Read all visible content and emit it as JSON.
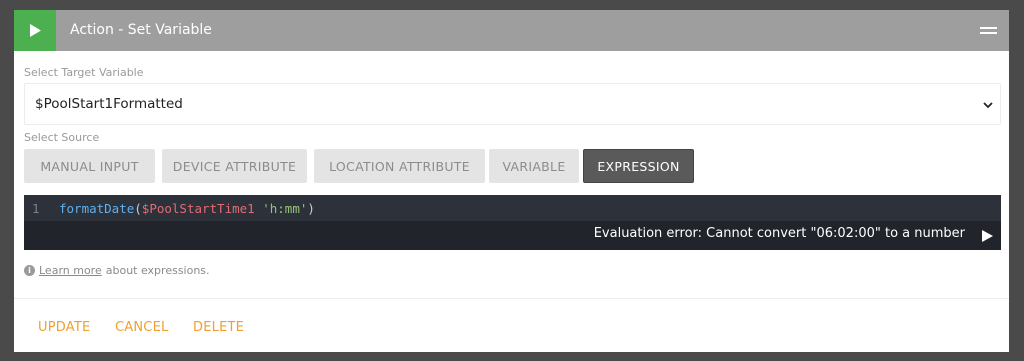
{
  "header": {
    "title": "Action - Set Variable",
    "play_icon": "play-icon",
    "menu_icon": "menu-icon",
    "accent_color": "#4caf50"
  },
  "target": {
    "label": "Select Target Variable",
    "value": "$PoolStart1Formatted"
  },
  "source": {
    "label": "Select Source",
    "buttons": [
      {
        "label": "MANUAL INPUT",
        "active": false
      },
      {
        "label": "DEVICE ATTRIBUTE",
        "active": false
      },
      {
        "label": "LOCATION ATTRIBUTE",
        "active": false
      },
      {
        "label": "VARIABLE",
        "active": false
      },
      {
        "label": "EXPRESSION",
        "active": true
      }
    ]
  },
  "editor": {
    "line_number": "1",
    "tokens": {
      "fn": "formatDate",
      "open": "(",
      "var": "$PoolStartTime1",
      "space": " ",
      "str": "'h:mm'",
      "close": ")"
    },
    "error": "Evaluation error: Cannot convert \"06:02:00\" to a number"
  },
  "help": {
    "link": "Learn more",
    "text": "about expressions."
  },
  "actions": {
    "update": "UPDATE",
    "cancel": "CANCEL",
    "delete": "DELETE",
    "color": "#f0a030"
  }
}
